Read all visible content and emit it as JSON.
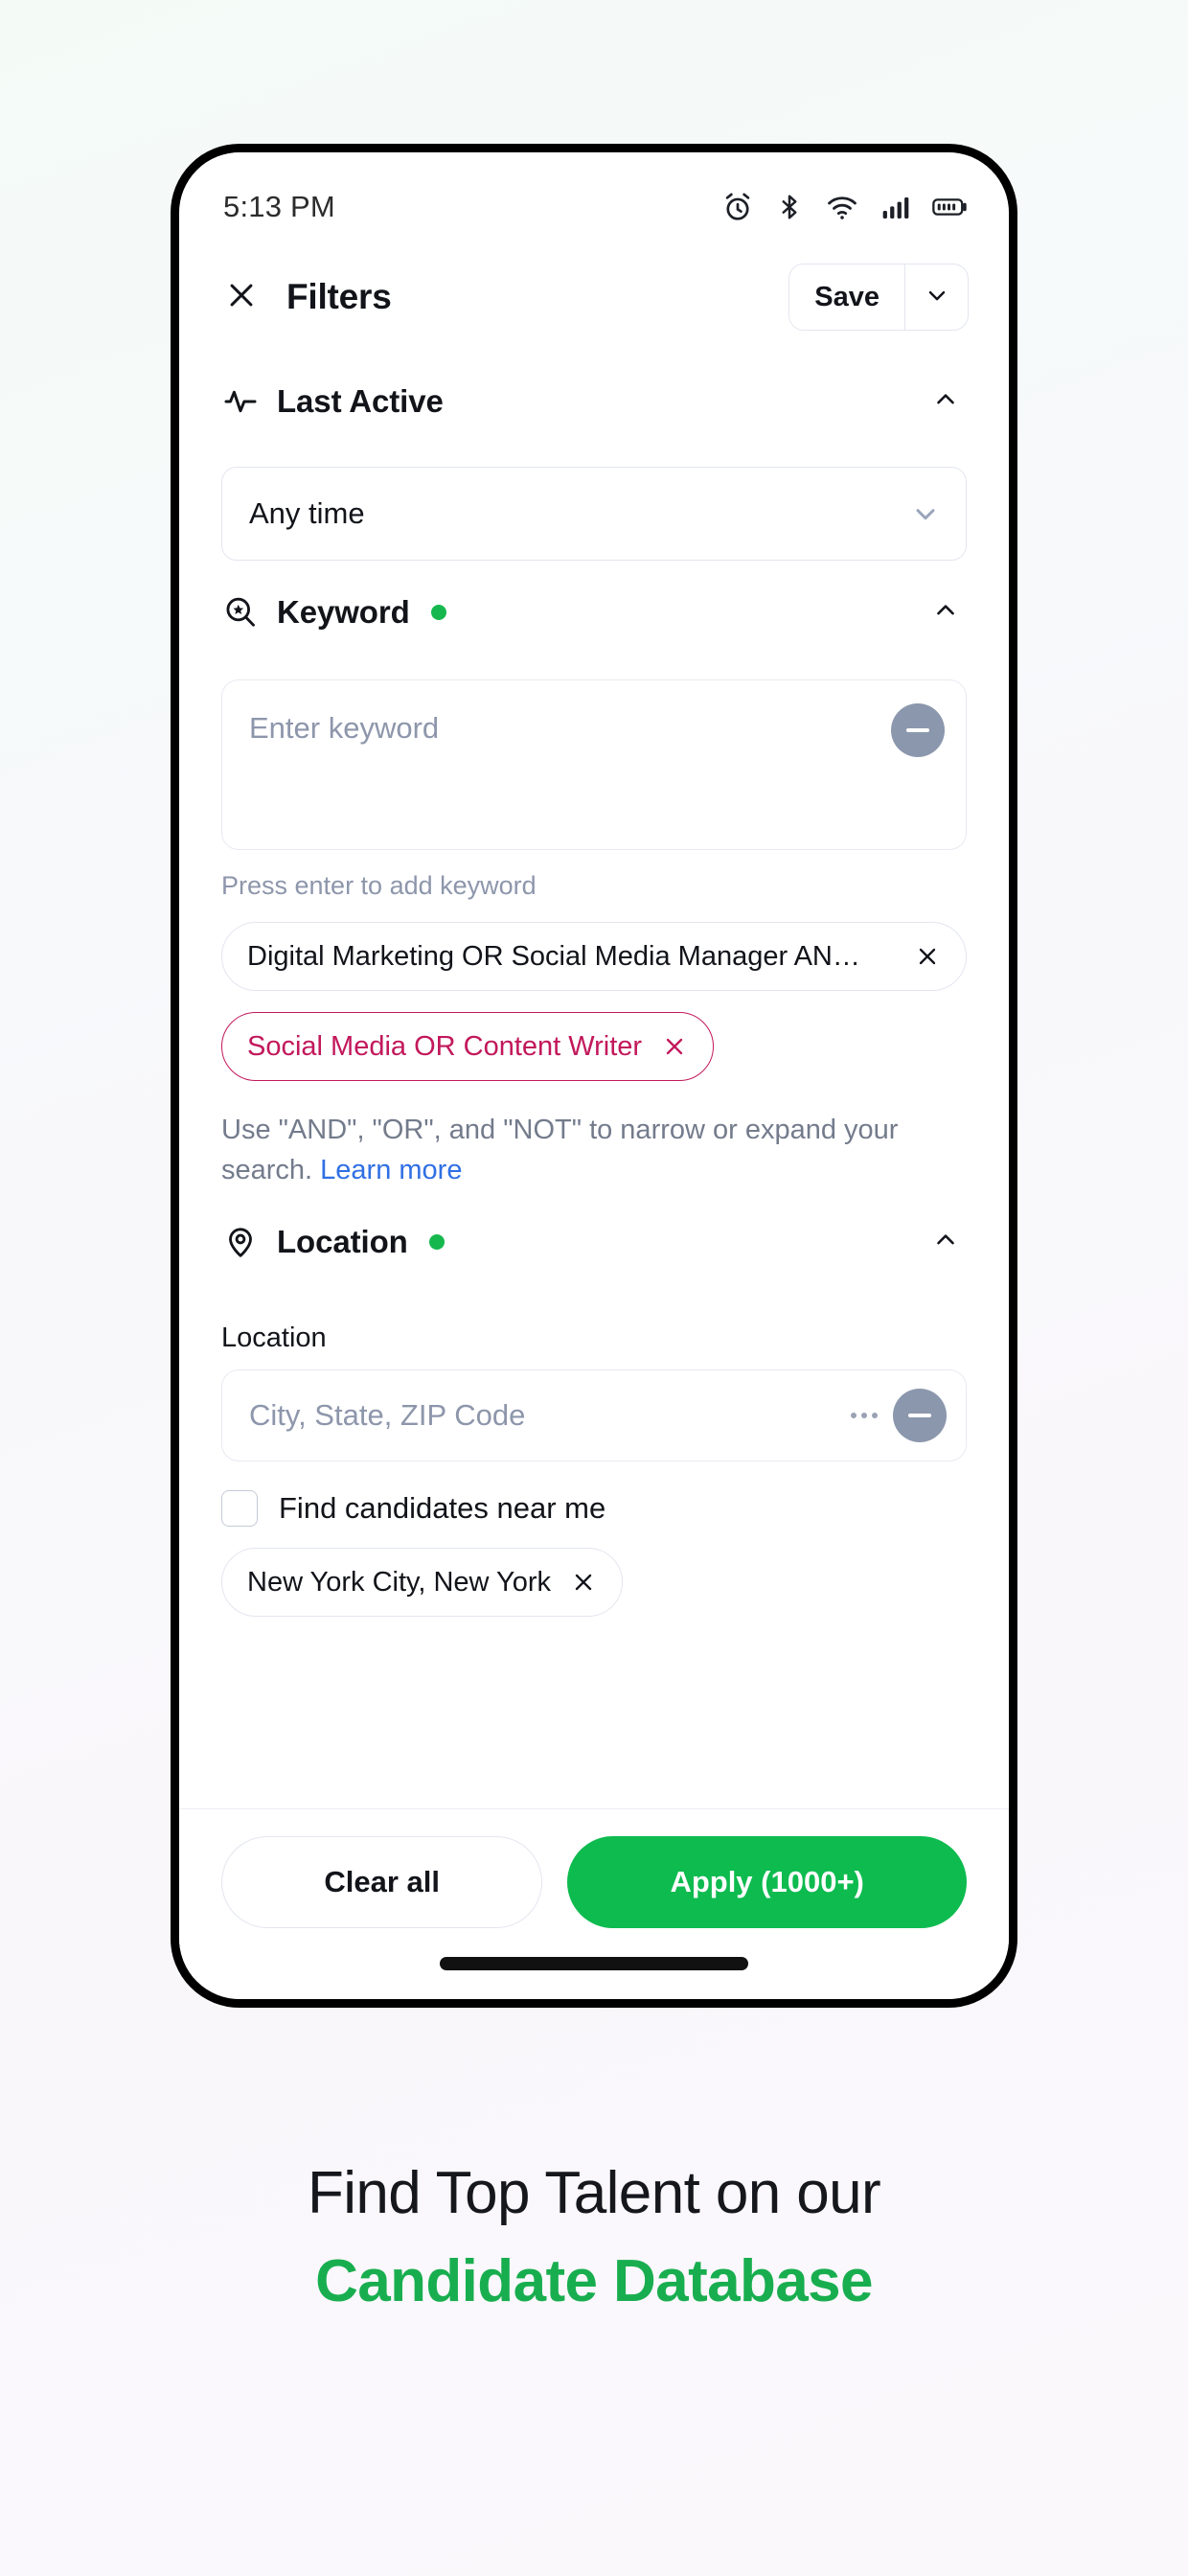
{
  "status_bar": {
    "time": "5:13 PM",
    "icons": [
      "alarm-clock-icon",
      "bluetooth-icon",
      "wifi-icon",
      "cellular-signal-icon",
      "battery-icon"
    ]
  },
  "header": {
    "close_icon": "close-icon",
    "title": "Filters",
    "save_label": "Save",
    "save_caret_icon": "chevron-down-icon"
  },
  "sections": {
    "last_active": {
      "icon": "activity-pulse-icon",
      "label": "Last Active",
      "collapse_icon": "chevron-up-icon",
      "select_value": "Any time",
      "select_caret_icon": "chevron-down-icon"
    },
    "keyword": {
      "icon": "search-star-icon",
      "label": "Keyword",
      "has_indicator": true,
      "collapse_icon": "chevron-up-icon",
      "input_placeholder": "Enter keyword",
      "clear_icon": "minus-circle-icon",
      "helper": "Press enter to add keyword",
      "chips": [
        {
          "text": "Digital Marketing OR Social Media Manager AN…",
          "style": "default",
          "remove_icon": "close-icon"
        },
        {
          "text": "Social Media OR Content Writer",
          "style": "danger",
          "remove_icon": "close-icon"
        }
      ],
      "note_prefix": "Use \"AND\", \"OR\", and \"NOT\" to narrow or expand your search. ",
      "note_link": "Learn more"
    },
    "location": {
      "icon": "map-pin-icon",
      "label": "Location",
      "has_indicator": true,
      "collapse_icon": "chevron-up-icon",
      "field_label": "Location",
      "input_placeholder": "City, State, ZIP Code",
      "more_icon": "ellipsis-icon",
      "clear_icon": "minus-circle-icon",
      "checkbox_label": "Find candidates near me",
      "checkbox_checked": false,
      "chips": [
        {
          "text": "New York City, New York",
          "remove_icon": "close-icon"
        }
      ]
    }
  },
  "footer": {
    "clear_label": "Clear all",
    "apply_label": "Apply (1000+)"
  },
  "caption": {
    "line1": "Find Top Talent on our",
    "line2": "Candidate Database"
  },
  "colors": {
    "accent_green": "#0dbb4f",
    "caption_green": "#18ae4f",
    "indicator_green": "#16b84e",
    "danger": "#c2185b",
    "link_blue": "#2f6fe4"
  }
}
